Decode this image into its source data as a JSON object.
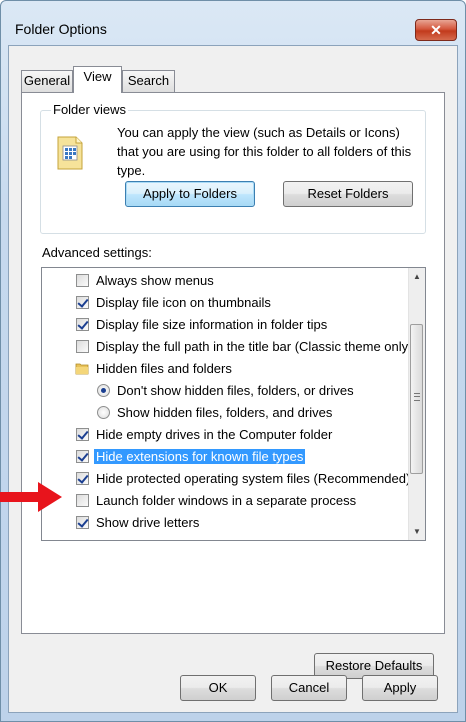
{
  "window": {
    "title": "Folder Options",
    "close_glyph": "✕"
  },
  "tabs": [
    {
      "label": "General",
      "active": false
    },
    {
      "label": "View",
      "active": true
    },
    {
      "label": "Search",
      "active": false
    }
  ],
  "folder_views": {
    "group_title": "Folder views",
    "description": "You can apply the view (such as Details or Icons) that you are using for this folder to all folders of this type.",
    "apply_button": "Apply to Folders",
    "reset_button": "Reset Folders",
    "icon": "folder-views-icon"
  },
  "advanced": {
    "label": "Advanced settings:",
    "items": [
      {
        "type": "checkbox",
        "checked": false,
        "label": "Always show menus",
        "level": 1
      },
      {
        "type": "checkbox",
        "checked": true,
        "label": "Display file icon on thumbnails",
        "level": 1
      },
      {
        "type": "checkbox",
        "checked": true,
        "label": "Display file size information in folder tips",
        "level": 1
      },
      {
        "type": "checkbox",
        "checked": false,
        "label": "Display the full path in the title bar (Classic theme only)",
        "level": 1
      },
      {
        "type": "folder",
        "label": "Hidden files and folders",
        "level": 1
      },
      {
        "type": "radio",
        "checked": true,
        "label": "Don't show hidden files, folders, or drives",
        "level": 2
      },
      {
        "type": "radio",
        "checked": false,
        "label": "Show hidden files, folders, and drives",
        "level": 2
      },
      {
        "type": "checkbox",
        "checked": true,
        "label": "Hide empty drives in the Computer folder",
        "level": 1
      },
      {
        "type": "checkbox",
        "checked": true,
        "label": "Hide extensions for known file types",
        "level": 1,
        "selected": true
      },
      {
        "type": "checkbox",
        "checked": true,
        "label": "Hide protected operating system files (Recommended)",
        "level": 1
      },
      {
        "type": "checkbox",
        "checked": false,
        "label": "Launch folder windows in a separate process",
        "level": 1
      },
      {
        "type": "checkbox",
        "checked": true,
        "label": "Show drive letters",
        "level": 1
      }
    ],
    "restore_button": "Restore Defaults"
  },
  "footer": {
    "ok": "OK",
    "cancel": "Cancel",
    "apply": "Apply"
  },
  "annotation": {
    "icon": "red-arrow-icon",
    "color": "#e8141c"
  },
  "colors": {
    "selection": "#3399ff",
    "default_button_border": "#3c7fb1",
    "close_button": "#c23a1c"
  }
}
